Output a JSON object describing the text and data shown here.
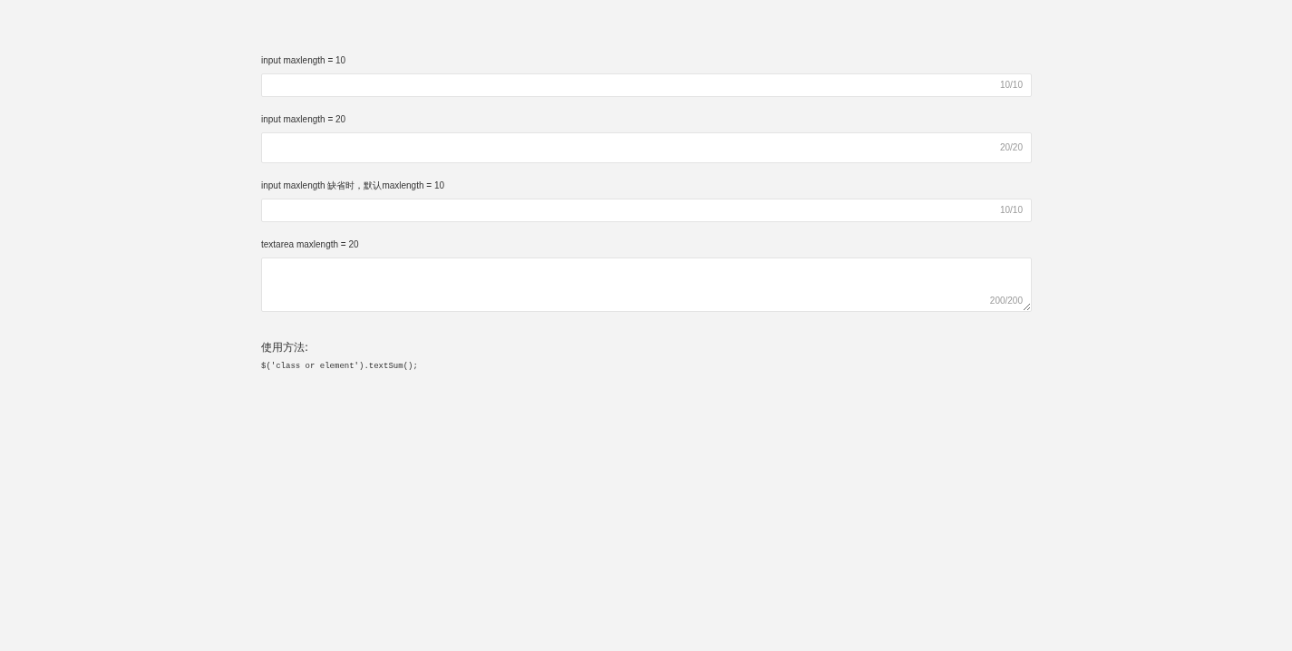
{
  "fields": [
    {
      "kind": "input",
      "label": "input maxlength = 10",
      "counter": "10/10"
    },
    {
      "kind": "input-tall",
      "label": "input maxlength = 20",
      "counter": "20/20"
    },
    {
      "kind": "input",
      "label": "input maxlength 缺省时，默认maxlength = 10",
      "counter": "10/10"
    },
    {
      "kind": "textarea",
      "label": "textarea maxlength = 20",
      "counter": "200/200"
    }
  ],
  "usage": {
    "heading": "使用方法:",
    "code": "$('class or element').textSum();"
  }
}
